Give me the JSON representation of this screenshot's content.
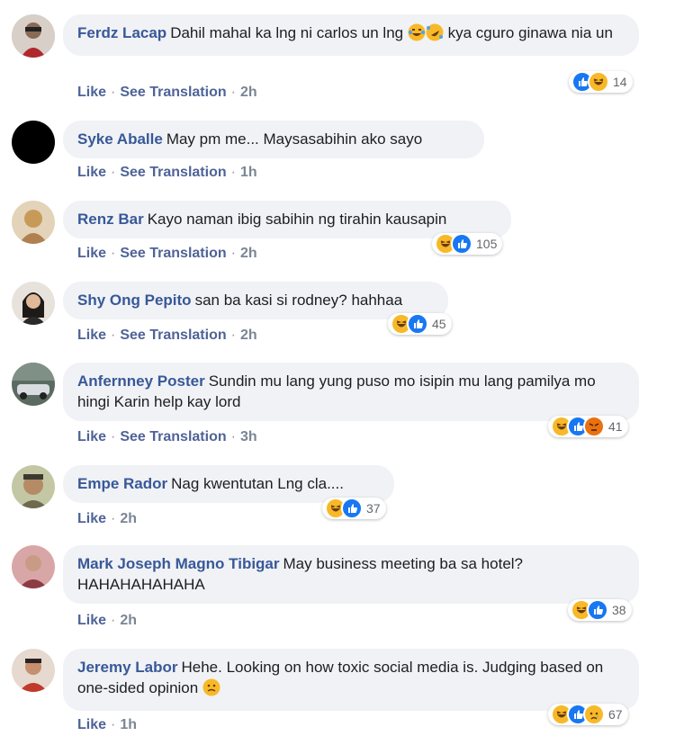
{
  "action_labels": {
    "like": "Like",
    "see_translation": "See Translation"
  },
  "reaction_colors": {
    "like": "#1877f2",
    "haha": "#f7b928",
    "angry": "#e9710f",
    "sad": "#f7b928"
  },
  "comments": [
    {
      "author": "Ferdz Lacap",
      "text_parts": [
        "Dahil mahal ka lng ni carlos un lng ",
        " kya cguro ginawa nia un"
      ],
      "inline_emojis": [
        "laughing-tears-emoji",
        "rofl-emoji"
      ],
      "time": "2h",
      "translation": true,
      "reactions": [
        "like",
        "haha"
      ],
      "count": "14"
    },
    {
      "author": "Syke Aballe",
      "text": "May pm me... Maysasabihin ako sayo",
      "time": "1h",
      "translation": true,
      "reactions": [],
      "count": ""
    },
    {
      "author": "Renz Bar",
      "text": "Kayo naman ibig sabihin ng tirahin kausapin",
      "time": "2h",
      "translation": true,
      "reactions": [
        "haha",
        "like"
      ],
      "count": "105"
    },
    {
      "author": "Shy Ong Pepito",
      "text": "san ba kasi si rodney? hahhaa",
      "time": "2h",
      "translation": true,
      "reactions": [
        "haha",
        "like"
      ],
      "count": "45"
    },
    {
      "author": "Anfernney Poster",
      "text": "Sundin mu lang yung puso mo isipin mu lang pamilya mo hingi Karin help kay lord",
      "time": "3h",
      "translation": true,
      "reactions": [
        "haha",
        "like",
        "angry"
      ],
      "count": "41"
    },
    {
      "author": "Empe Rador",
      "text": "Nag kwentutan Lng cla....",
      "time": "2h",
      "translation": false,
      "reactions": [
        "haha",
        "like"
      ],
      "count": "37"
    },
    {
      "author": "Mark Joseph Magno Tibigar",
      "text": "May business meeting ba sa hotel? HAHAHAHAHAHA",
      "time": "2h",
      "translation": false,
      "reactions": [
        "haha",
        "like"
      ],
      "count": "38"
    },
    {
      "author": "Jeremy Labor",
      "text": "Hehe. Looking on how toxic social media is. Judging based on one-sided opinion ",
      "inline_emojis": [
        "frowning-emoji"
      ],
      "time": "1h",
      "translation": false,
      "reactions": [
        "haha",
        "like",
        "sad"
      ],
      "count": "67"
    }
  ]
}
